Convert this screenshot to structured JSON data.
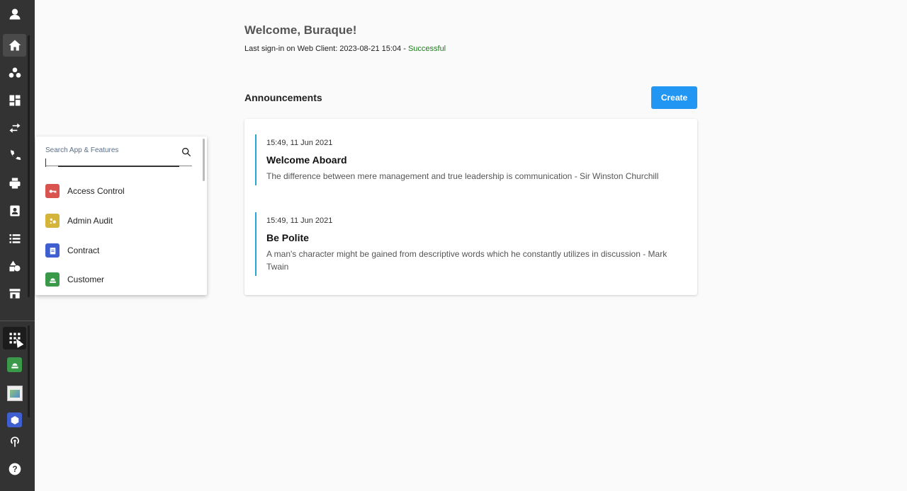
{
  "sidebar": {
    "icons": [
      "user-icon",
      "home-icon",
      "groups-icon",
      "dashboard-icon",
      "transfer-icon",
      "phone-icon",
      "print-icon",
      "contact-icon",
      "list-icon",
      "shapes-icon",
      "store-icon",
      "apps-grid-icon",
      "customer-app-icon",
      "broken-image-icon",
      "package-icon",
      "broadcast-icon",
      "help-icon"
    ]
  },
  "search": {
    "placeholder": "Search App & Features"
  },
  "apps": [
    {
      "label": "Access Control",
      "icon": "key-icon",
      "color": "#d9534f"
    },
    {
      "label": "Admin Audit",
      "icon": "audit-icon",
      "color": "#d4b53a"
    },
    {
      "label": "Contract",
      "icon": "clipboard-icon",
      "color": "#3f5ecf"
    },
    {
      "label": "Customer",
      "icon": "customer-icon",
      "color": "#3a9a4a"
    }
  ],
  "main": {
    "welcome": "Welcome, Buraque!",
    "signin_prefix": "Last sign-in on Web Client: 2023-08-21 15:04 - ",
    "signin_status": "Successful",
    "announcements_title": "Announcements",
    "create_label": "Create",
    "announcements": [
      {
        "date": "15:49, 11 Jun 2021",
        "title": "Welcome Aboard",
        "body": "The difference between mere management and true leadership is communication - Sir Winston Churchill"
      },
      {
        "date": "15:49, 11 Jun 2021",
        "title": "Be Polite",
        "body": "A man's character might be gained from descriptive words which he constantly utilizes in discussion - Mark Twain"
      }
    ]
  },
  "colors": {
    "sidebar_bg": "#333333",
    "accent": "#2196f3",
    "success": "#1a7f1a",
    "announcement_border": "#29a5d6"
  }
}
